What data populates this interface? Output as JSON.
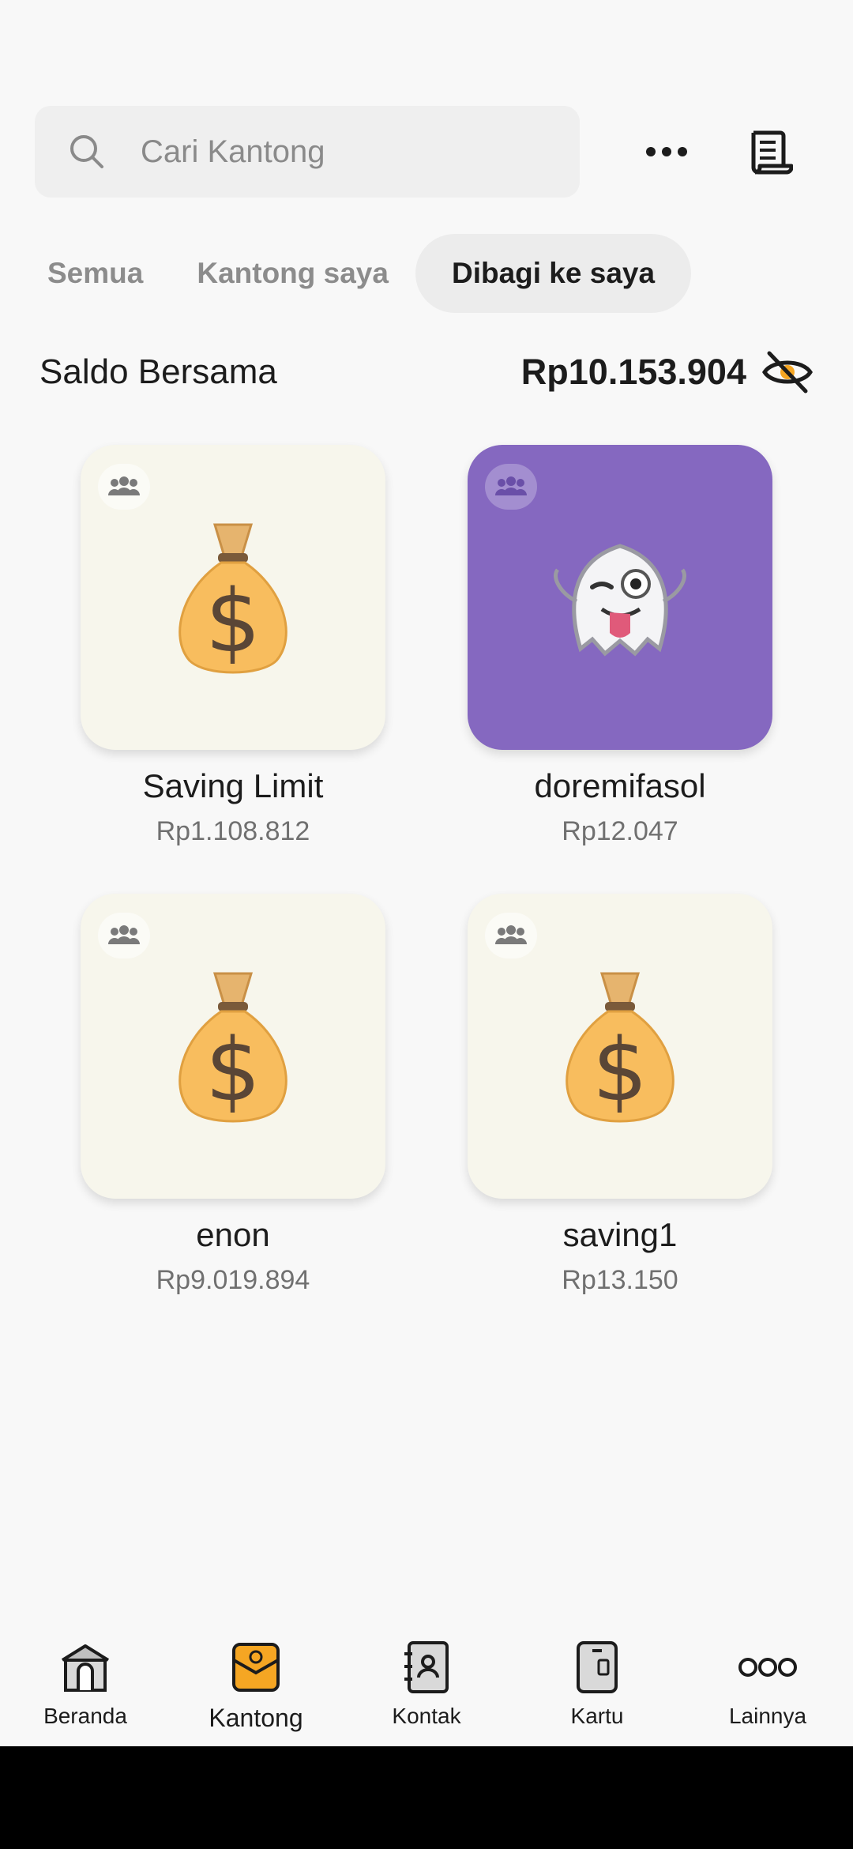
{
  "search": {
    "placeholder": "Cari Kantong"
  },
  "tabs": [
    {
      "label": "Semua",
      "active": false
    },
    {
      "label": "Kantong saya",
      "active": false
    },
    {
      "label": "Dibagi ke saya",
      "active": true
    }
  ],
  "balance": {
    "label": "Saldo Bersama",
    "value": "Rp10.153.904"
  },
  "pockets": [
    {
      "name": "Saving Limit",
      "amount": "Rp1.108.812",
      "icon": "money-bag",
      "color": "#f7f6ec"
    },
    {
      "name": "doremifasol",
      "amount": "Rp12.047",
      "icon": "ghost",
      "color": "#8568c0"
    },
    {
      "name": "enon",
      "amount": "Rp9.019.894",
      "icon": "money-bag",
      "color": "#f7f6ec"
    },
    {
      "name": "saving1",
      "amount": "Rp13.150",
      "icon": "money-bag",
      "color": "#f7f6ec"
    }
  ],
  "nav": [
    {
      "label": "Beranda",
      "icon": "home-icon"
    },
    {
      "label": "Kantong",
      "icon": "pocket-icon",
      "active": true
    },
    {
      "label": "Kontak",
      "icon": "contacts-icon"
    },
    {
      "label": "Kartu",
      "icon": "card-icon"
    },
    {
      "label": "Lainnya",
      "icon": "more-icon"
    }
  ],
  "colors": {
    "accent": "#f5a623",
    "purple": "#8568c0",
    "card": "#f7f6ec"
  }
}
